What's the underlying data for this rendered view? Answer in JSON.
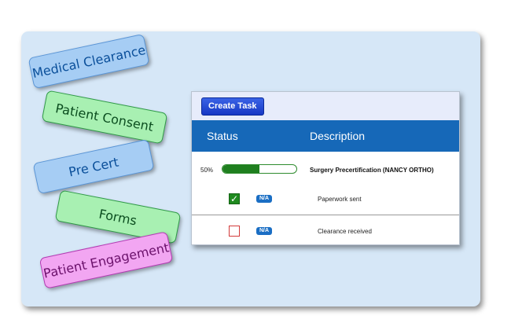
{
  "tags": [
    {
      "label": "Medical Clearance",
      "color": "blue"
    },
    {
      "label": "Patient Consent",
      "color": "green"
    },
    {
      "label": "Pre Cert",
      "color": "blue"
    },
    {
      "label": "Forms",
      "color": "green"
    },
    {
      "label": "Patient Engagement",
      "color": "pink"
    }
  ],
  "toolbar": {
    "create_task_label": "Create Task"
  },
  "table": {
    "headers": {
      "status": "Status",
      "description": "Description"
    },
    "task": {
      "progress_label": "50%",
      "progress_fraction": 0.5,
      "description": "Surgery Precertification (NANCY ORTHO)"
    },
    "subtasks": [
      {
        "checked": true,
        "badge": "N/A",
        "description": "Paperwork sent"
      },
      {
        "checked": false,
        "badge": "N/A",
        "description": "Clearance received"
      }
    ]
  },
  "colors": {
    "header_bar": "#1668b8",
    "panel_bg": "#d6e7f7",
    "progress_green": "#1f7f1f",
    "unchecked_border": "#d33a3a"
  }
}
